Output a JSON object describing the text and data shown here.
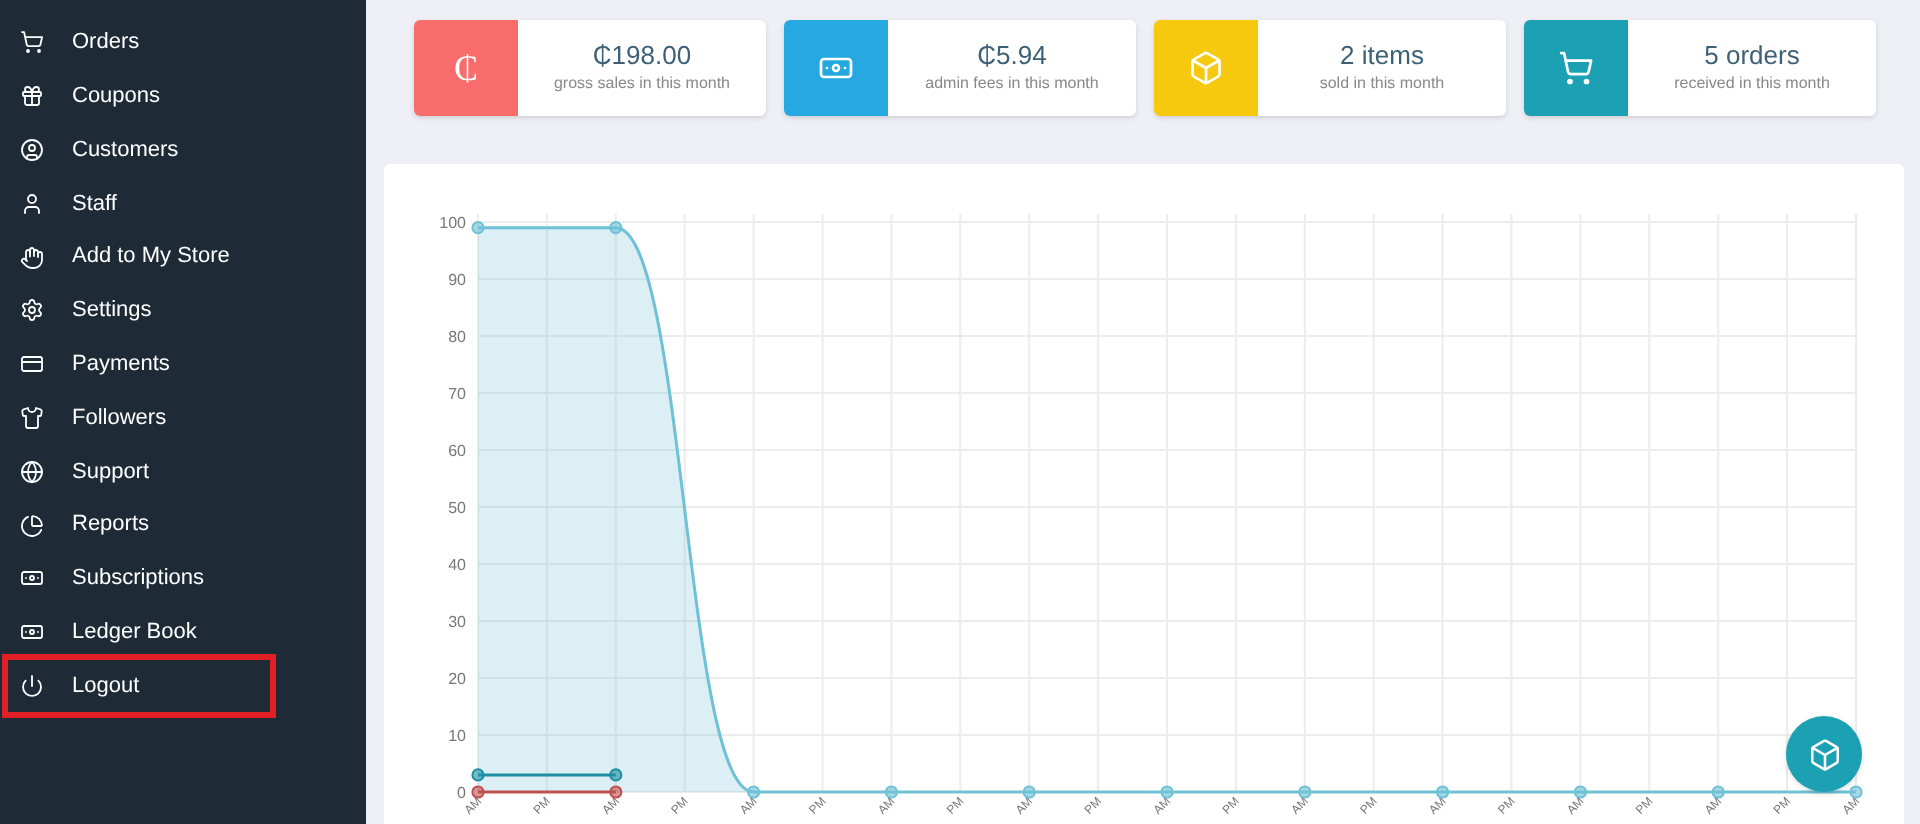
{
  "sidebar": {
    "items": [
      {
        "label": "Orders",
        "highlighted": false
      },
      {
        "label": "Coupons",
        "highlighted": false
      },
      {
        "label": "Customers",
        "highlighted": false
      },
      {
        "label": "Staff",
        "highlighted": false
      },
      {
        "label": "Add to My Store",
        "highlighted": false
      },
      {
        "label": "Settings",
        "highlighted": false
      },
      {
        "label": "Payments",
        "highlighted": false
      },
      {
        "label": "Followers",
        "highlighted": false
      },
      {
        "label": "Support",
        "highlighted": false
      },
      {
        "label": "Reports",
        "highlighted": false
      },
      {
        "label": "Subscriptions",
        "highlighted": false
      },
      {
        "label": "Ledger Book",
        "highlighted": false
      },
      {
        "label": "Logout",
        "highlighted": true
      }
    ]
  },
  "stats": [
    {
      "value": "₵198.00",
      "caption": "gross sales in this month",
      "color": "#f96c6c",
      "symbol": "₵"
    },
    {
      "value": "₵5.94",
      "caption": "admin fees in this month",
      "color": "#26a9e0"
    },
    {
      "value": "2 items",
      "caption": "sold in this month",
      "color": "#f6c90e"
    },
    {
      "value": "5 orders",
      "caption": "received in this month",
      "color": "#1ba1b3"
    }
  ],
  "chart": {
    "chart_data": {
      "type": "line",
      "grid": true,
      "categories": [
        "AM",
        "PM",
        "AM",
        "PM",
        "AM",
        "PM",
        "AM",
        "PM",
        "AM",
        "PM",
        "AM",
        "PM",
        "AM",
        "PM",
        "AM",
        "PM",
        "AM",
        "PM",
        "AM",
        "PM",
        "AM"
      ],
      "ylim": [
        0,
        100
      ],
      "yticks": [
        0,
        10,
        20,
        30,
        40,
        50,
        60,
        70,
        80,
        90,
        100
      ],
      "series": [
        {
          "color": "#6ec1d6",
          "marker": "circle",
          "values": [
            99,
            null,
            99,
            null,
            0,
            null,
            0,
            null,
            0,
            null,
            0,
            null,
            0,
            null,
            0,
            null,
            0,
            null,
            0,
            null,
            0
          ]
        },
        {
          "color": "#1e8fa3",
          "marker": "circle",
          "values": [
            3,
            null,
            3,
            null,
            null,
            null,
            null,
            null,
            null,
            null,
            null,
            null,
            null,
            null,
            null,
            null,
            null,
            null,
            null,
            null,
            null
          ]
        },
        {
          "color": "#c0504d",
          "marker": "circle",
          "values": [
            0,
            null,
            0,
            null,
            null,
            null,
            null,
            null,
            null,
            null,
            null,
            null,
            null,
            null,
            null,
            null,
            null,
            null,
            null,
            null,
            null
          ]
        }
      ]
    }
  }
}
